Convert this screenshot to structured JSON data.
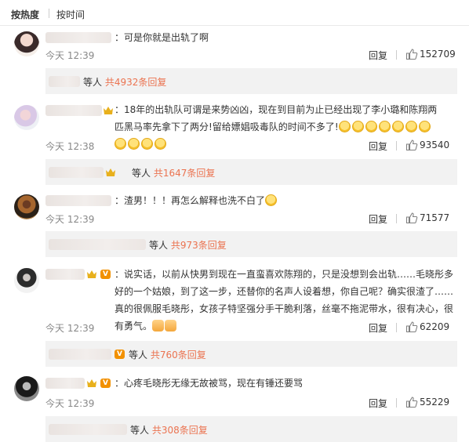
{
  "sort": {
    "hot_label": "按热度",
    "time_label": "按时间"
  },
  "comments": [
    {
      "text": "：可是你就是出轨了啊",
      "time": "今天 12:39",
      "reply_label": "回复",
      "likes": "152709",
      "replies_prefix": "等人",
      "replies_count": "共4932条回复"
    },
    {
      "text": "：18年的出轨队可谓是来势凶凶，现在到目前为止已经出现了李小璐和陈翔两匹黑马率先拿下了两分!留给嫖娼吸毒队的时间不多了!",
      "time": "今天 12:38",
      "reply_label": "回复",
      "likes": "93540",
      "replies_prefix": "等人",
      "replies_count": "共1647条回复"
    },
    {
      "text": "：渣男！！！再怎么解释也洗不白了",
      "time": "今天 12:39",
      "reply_label": "回复",
      "likes": "71577",
      "replies_prefix": "等人",
      "replies_count": "共973条回复"
    },
    {
      "text": "：说实话，以前从快男到现在一直蛮喜欢陈翔的，只是没想到会出轨……毛晓彤多好的一个姑娘，到了这一步，还替你的名声人设着想，你自己呢？确实很渣了……真的很佩服毛晓彤，女孩子特坚强分手干脆利落，丝毫不拖泥带水，很有决心，很有勇气。",
      "time": "今天 12:39",
      "reply_label": "回复",
      "likes": "62209",
      "replies_prefix": "等人",
      "replies_count": "共760条回复"
    },
    {
      "text": "：心疼毛晓彤无缘无故被骂，现在有锤还要骂",
      "time": "今天 12:39",
      "reply_label": "回复",
      "likes": "55229",
      "replies_prefix": "等人",
      "replies_count": "共308条回复"
    }
  ]
}
